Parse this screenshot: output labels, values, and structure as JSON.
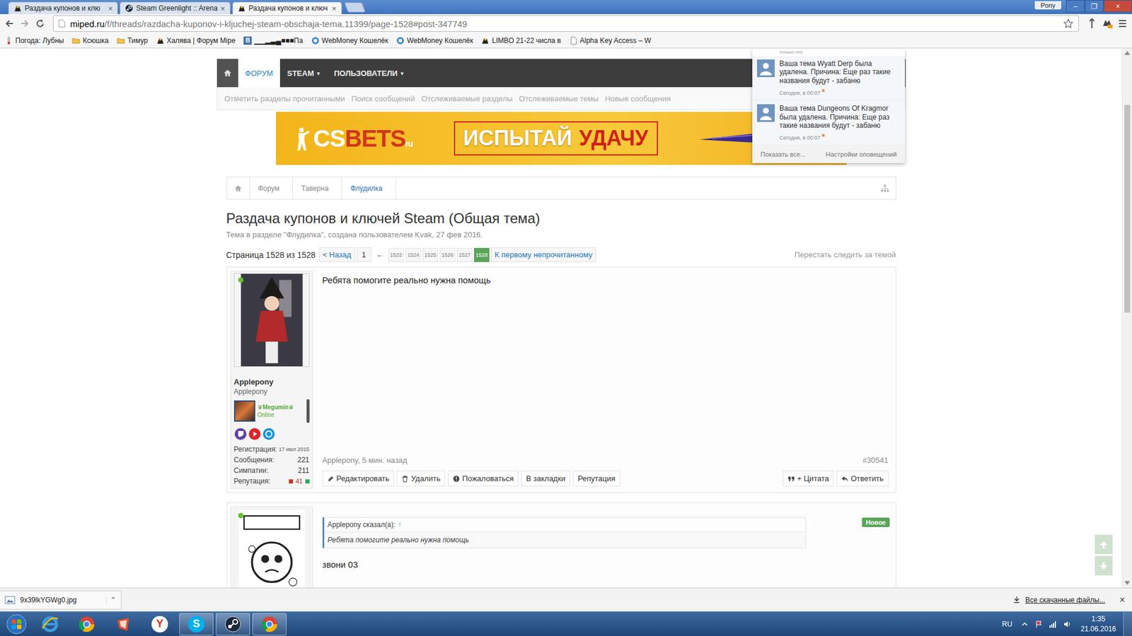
{
  "browser": {
    "tabs": [
      {
        "label": "Раздача купонов и клю",
        "icon": "miped",
        "selected": false
      },
      {
        "label": "Steam Greenlight :: Arena",
        "icon": "steam",
        "selected": false
      },
      {
        "label": "Раздача купонов и ключ",
        "icon": "miped",
        "selected": true
      }
    ],
    "tab_close": "×",
    "profile": "Pony",
    "window_buttons": [
      "–",
      "❐",
      "×"
    ],
    "url_host": "miped.ru",
    "url_path": "/f/threads/razdacha-kuponov-i-kljuchej-steam-obschaja-tema.11399/page-1528#post-347749",
    "bookmarks": [
      {
        "label": "Погода: Лубны",
        "icon": "weather",
        "glyph": ""
      },
      {
        "label": "Ксюшка",
        "icon": "folder",
        "glyph": ""
      },
      {
        "label": "Тимур",
        "icon": "folder",
        "glyph": ""
      },
      {
        "label": "Халява | Форум Mipe",
        "icon": "miped",
        "glyph": ""
      },
      {
        "label": "▁▁▂▃▄■■■Па",
        "icon": "vk",
        "glyph": "В"
      },
      {
        "label": "WebMoney Кошелёк",
        "icon": "webmoney",
        "glyph": ""
      },
      {
        "label": "WebMoney Кошелёк",
        "icon": "webmoney",
        "glyph": ""
      },
      {
        "label": "LIMBO 21-22 числа в",
        "icon": "miped",
        "glyph": ""
      },
      {
        "label": "Alpha Key Access – W",
        "icon": "page",
        "glyph": ""
      }
    ]
  },
  "forum": {
    "nav": [
      {
        "label": "ФОРУМ",
        "caret": "",
        "selected": true
      },
      {
        "label": "STEAM",
        "caret": "▾",
        "selected": false
      },
      {
        "label": "ПОЛЬЗОВАТЕЛИ",
        "caret": "▾",
        "selected": false
      }
    ],
    "subnav": [
      "Отметить разделы прочитанными",
      "Поиск сообщений",
      "Отслеживаемые разделы",
      "Отслеживаемые темы",
      "Новые сообщения"
    ],
    "banner": {
      "logo_a": "CS",
      "logo_b": "BETS",
      "logo_c": "ru",
      "slogan_a": "ИСПЫТАЙ",
      "slogan_b": "УДАЧУ"
    },
    "notifications": {
      "cut_top": "только что",
      "marker": "*",
      "items": [
        {
          "text": "Ваша тема Wyatt Derp была удалена. Причина: Еще раз такие названия будут - забаню",
          "time": "Сегодня, в 00:07",
          "unread": true
        },
        {
          "text": "Ваша тема Dungeons Of Kragmor была удалена. Причина: Еще раз такие названия будут - забаню",
          "time": "Сегодня, в 00:07",
          "unread": true
        }
      ],
      "footer": [
        "Показать все...",
        "Настройки оповещений"
      ]
    },
    "breadcrumbs": [
      {
        "label": "Форум",
        "current": false
      },
      {
        "label": "Таверна",
        "current": false
      },
      {
        "label": "Флудилка",
        "current": true
      }
    ],
    "thread": {
      "title": "Раздача купонов и ключей Steam (Общая тема)",
      "meta": "Тема в разделе \"Флудилка\", создана пользователем Kvak, 27 фев 2016."
    },
    "pagination": {
      "summary": "Страница 1528 из 1528",
      "prev": "< Назад",
      "first": "1",
      "gap": "←",
      "pages": [
        {
          "label": "1523",
          "selected": false
        },
        {
          "label": "1524",
          "selected": false
        },
        {
          "label": "1525",
          "selected": false
        },
        {
          "label": "1526",
          "selected": false
        },
        {
          "label": "1527",
          "selected": false
        },
        {
          "label": "1528",
          "selected": true
        }
      ],
      "unread": "К первому непрочитанному",
      "unwatch": "Перестать следить за темой"
    },
    "post": {
      "author": "Applepony",
      "user_title": "Applepony",
      "online": true,
      "badge": "♛Megumin♛",
      "badge_status": "Online",
      "social": [
        {
          "kind": "twitch",
          "color": "#6441a5"
        },
        {
          "kind": "youtube",
          "color": "#d7282f"
        },
        {
          "kind": "skype",
          "color": "#1a97d9"
        }
      ],
      "stats": [
        {
          "label": "Регистрация:",
          "value": "17 июл 2015",
          "kind": "plain"
        },
        {
          "label": "Сообщения:",
          "value": "221",
          "kind": "plain"
        },
        {
          "label": "Симпатии:",
          "value": "211",
          "kind": "plain"
        },
        {
          "label": "Репутация:",
          "value": "41",
          "kind": "reputation"
        }
      ],
      "body": "Ребята помогите реально нужна помощь",
      "byline": "Applepony, 5 мин. назад",
      "number": "#30541",
      "actions": [
        {
          "label": "Редактировать",
          "kind": "edit"
        },
        {
          "label": "Удалить",
          "kind": "delete"
        },
        {
          "label": "Пожаловаться",
          "kind": "report"
        },
        {
          "label": "В закладки",
          "kind": "plain"
        },
        {
          "label": "Репутация",
          "kind": "plain"
        }
      ],
      "replies": [
        {
          "label": "+ Цитата",
          "kind": "quote"
        },
        {
          "label": "Ответить",
          "kind": "reply"
        }
      ]
    },
    "next_post": {
      "online": true,
      "quote_author": "Applepony сказал(а):",
      "quote_arrow": "↑",
      "quote_text": "Ребята помогите реально нужна помощь",
      "body": "звони 03",
      "badge": "Новое"
    }
  },
  "scrollbar": {
    "offset": 0.09,
    "size": 0.4
  },
  "downloads": {
    "file": "9x39lkYGWg0.jpg",
    "caret": "⌃",
    "all": "Все скачанные файлы...",
    "close": "×"
  },
  "taskbar": {
    "apps": [
      {
        "kind": "ie",
        "glyph": "",
        "running": false
      },
      {
        "kind": "chrome",
        "glyph": "",
        "running": false
      },
      {
        "kind": "app",
        "glyph": "",
        "running": false
      },
      {
        "kind": "yandex",
        "glyph": "Y",
        "running": false
      },
      {
        "kind": "skype",
        "glyph": "S",
        "running": true
      },
      {
        "kind": "steam",
        "glyph": "",
        "running": true
      },
      {
        "kind": "chrome",
        "glyph": "",
        "running": true
      }
    ],
    "lang": "RU",
    "time": "1:35",
    "date": "21.06.2016"
  }
}
